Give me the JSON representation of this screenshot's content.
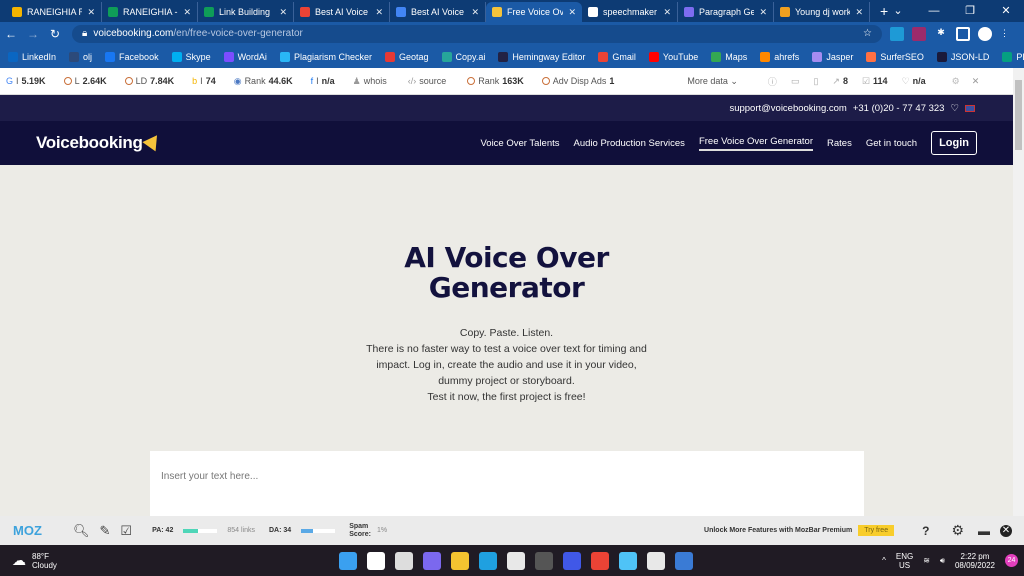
{
  "browser": {
    "tabs": [
      {
        "title": "RANEIGHIA R",
        "color": "#f4b400",
        "active": false
      },
      {
        "title": "RANEIGHIA - I",
        "color": "#0f9d58",
        "active": false
      },
      {
        "title": "Link Building",
        "color": "#0f9d58",
        "active": false
      },
      {
        "title": "Best AI Voice",
        "color": "#ea4335",
        "active": false
      },
      {
        "title": "Best AI Voice",
        "color": "#4285f4",
        "active": false
      },
      {
        "title": "Free Voice Ove",
        "color": "#f5c33b",
        "active": true
      },
      {
        "title": "speechmaker",
        "color": "#ffffff",
        "active": false
      },
      {
        "title": "Paragraph Ge",
        "color": "#7d6cf0",
        "active": false
      },
      {
        "title": "Young dj work",
        "color": "#f0a020",
        "active": false
      }
    ],
    "new_tab": "+",
    "url_domain": "voicebooking.com",
    "url_path": "/en/free-voice-over-generator",
    "bookmarks": [
      {
        "label": "LinkedIn",
        "color": "#0a66c2"
      },
      {
        "label": "olj",
        "color": "#2c4a7a"
      },
      {
        "label": "Facebook",
        "color": "#1877f2"
      },
      {
        "label": "Skype",
        "color": "#00aff0"
      },
      {
        "label": "WordAi",
        "color": "#7c4dff"
      },
      {
        "label": "Plagiarism Checker",
        "color": "#29b6f6"
      },
      {
        "label": "Geotag",
        "color": "#e53935"
      },
      {
        "label": "Copy.ai",
        "color": "#26a69a"
      },
      {
        "label": "Hemingway Editor",
        "color": "#222244"
      },
      {
        "label": "Gmail",
        "color": "#ea4335"
      },
      {
        "label": "YouTube",
        "color": "#ff0000"
      },
      {
        "label": "Maps",
        "color": "#34a853"
      },
      {
        "label": "ahrefs",
        "color": "#ff8800"
      },
      {
        "label": "Jasper",
        "color": "#a58cf0"
      },
      {
        "label": "SurferSEO",
        "color": "#ff7043"
      },
      {
        "label": "JSON-LD",
        "color": "#1a1a3a"
      },
      {
        "label": "PEXELS",
        "color": "#05a081"
      }
    ]
  },
  "seo_bar": {
    "items": [
      {
        "label": "I",
        "value": "5.19K"
      },
      {
        "label": "L",
        "value": "2.64K"
      },
      {
        "label": "LD",
        "value": "7.84K"
      },
      {
        "label": "I",
        "value": "74"
      },
      {
        "label": "Rank",
        "value": "44.6K"
      },
      {
        "label": "I",
        "value": "n/a"
      },
      {
        "label": "whois",
        "value": ""
      },
      {
        "label": "source",
        "value": ""
      },
      {
        "label": "Rank",
        "value": "163K"
      },
      {
        "label": "Adv Disp Ads",
        "value": "1"
      }
    ],
    "more_data": "More data",
    "ext_links": "8",
    "indexed": "114",
    "score": "n/a"
  },
  "site": {
    "email": "support@voicebooking.com",
    "phone": "+31 (0)20 - 77 47 323",
    "logo": "Voicebooking",
    "nav": [
      "Voice Over Talents",
      "Audio Production Services",
      "Free Voice Over Generator",
      "Rates",
      "Get in touch"
    ],
    "login": "Login",
    "title": "AI Voice Over Generator",
    "lines": [
      "Copy. Paste. Listen.",
      "There is no faster way to test a voice over text for timing and",
      "impact. Log in, create the audio and use it in your video,",
      "dummy project or storyboard.",
      "Test it now, the first project is free!"
    ],
    "placeholder": "Insert your text here..."
  },
  "mozbar": {
    "logo": "MOZ",
    "pa": "PA: 42",
    "pa_pct": 42,
    "links": "854 links",
    "da": "DA: 34",
    "da_pct": 34,
    "spam_label1": "Spam",
    "spam_label2": "Score:",
    "spam": "1%",
    "promo": "Unlock More Features with MozBar Premium",
    "try": "Try free",
    "help": "?"
  },
  "taskbar": {
    "temp": "88°F",
    "weather": "Cloudy",
    "lang1": "ENG",
    "lang2": "US",
    "time": "2:22 pm",
    "date": "08/09/2022",
    "badge": "24",
    "apps": [
      "#3aa0f0",
      "#ffffff",
      "#dddddd",
      "#7b68ee",
      "#f4c430",
      "#1fa0e0",
      "#e8e8e8",
      "#555555",
      "#4058e8",
      "#ea4335",
      "#4fc3f7",
      "#e8e8e8",
      "#3a7bd5"
    ]
  }
}
